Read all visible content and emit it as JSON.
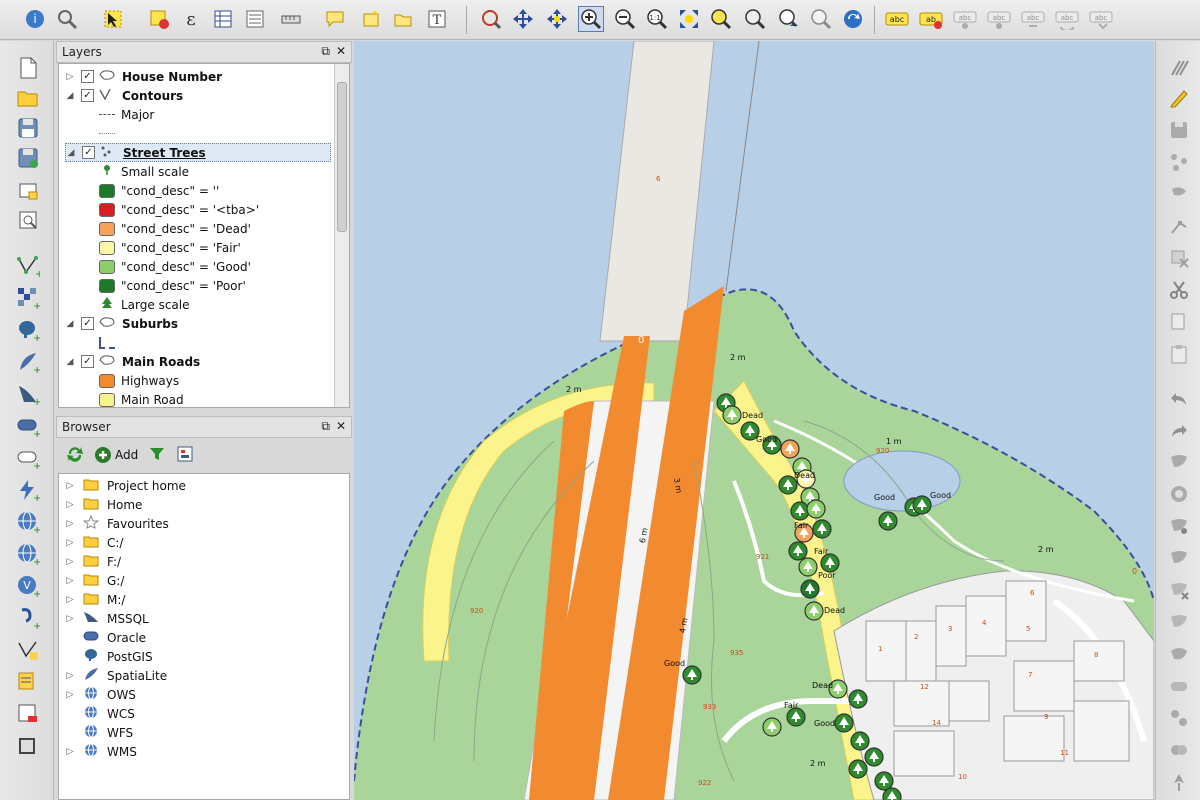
{
  "layers_panel": {
    "title": "Layers",
    "float_glyph": "⧉",
    "close_glyph": "✕",
    "items": [
      {
        "label": "House Number",
        "type": "group",
        "bold": true,
        "checked": true,
        "icon": "polygon-layer-icon"
      },
      {
        "label": "Contours",
        "type": "group",
        "bold": true,
        "checked": true,
        "icon": "line-layer-icon"
      },
      {
        "label": "Major",
        "type": "legend",
        "symbol": "dashed-line"
      },
      {
        "label": "",
        "type": "legend",
        "symbol": "dotted-line"
      },
      {
        "label": "Street Trees",
        "type": "group",
        "bold": true,
        "checked": true,
        "selected": true,
        "icon": "point-layer-icon"
      },
      {
        "label": "Small scale",
        "type": "legend",
        "symbol": "small-tree",
        "color": "#2e8b2e"
      },
      {
        "label": "\"cond_desc\" = ''",
        "type": "legend",
        "symbol": "swatch",
        "color": "#1d7a2a"
      },
      {
        "label": "\"cond_desc\" = '<tba>'",
        "type": "legend",
        "symbol": "swatch",
        "color": "#d81e1e"
      },
      {
        "label": "\"cond_desc\" = 'Dead'",
        "type": "legend",
        "symbol": "swatch",
        "color": "#f5a25a"
      },
      {
        "label": "\"cond_desc\" = 'Fair'",
        "type": "legend",
        "symbol": "swatch",
        "color": "#fbf6a8"
      },
      {
        "label": "\"cond_desc\" = 'Good'",
        "type": "legend",
        "symbol": "swatch",
        "color": "#8ccf6a"
      },
      {
        "label": "\"cond_desc\" = 'Poor'",
        "type": "legend",
        "symbol": "swatch",
        "color": "#1d7a2a"
      },
      {
        "label": "Large scale",
        "type": "legend",
        "symbol": "large-tree",
        "color": "#2e8b2e"
      },
      {
        "label": "Suburbs",
        "type": "group",
        "bold": true,
        "checked": true,
        "icon": "polygon-layer-icon"
      },
      {
        "label": "",
        "type": "legend",
        "symbol": "dashed-blue"
      },
      {
        "label": "Main Roads",
        "type": "group",
        "bold": true,
        "checked": true,
        "icon": "polygon-layer-icon"
      },
      {
        "label": "Highways",
        "type": "legend",
        "symbol": "swatch",
        "color": "#f28a30"
      },
      {
        "label": "Main Road",
        "type": "legend",
        "symbol": "swatch",
        "color": "#fbf48c"
      }
    ]
  },
  "browser_panel": {
    "title": "Browser",
    "float_glyph": "⧉",
    "close_glyph": "✕",
    "add_label": "Add",
    "items": [
      {
        "label": "Project home",
        "icon": "folder-icon",
        "expandable": true
      },
      {
        "label": "Home",
        "icon": "folder-icon",
        "expandable": true
      },
      {
        "label": "Favourites",
        "icon": "star-icon",
        "expandable": true
      },
      {
        "label": "C:/",
        "icon": "folder-icon",
        "expandable": true
      },
      {
        "label": "F:/",
        "icon": "folder-icon",
        "expandable": true
      },
      {
        "label": "G:/",
        "icon": "folder-icon",
        "expandable": true
      },
      {
        "label": "M:/",
        "icon": "folder-icon",
        "expandable": true
      },
      {
        "label": "MSSQL",
        "icon": "mssql-icon",
        "expandable": true
      },
      {
        "label": "Oracle",
        "icon": "oracle-icon",
        "expandable": false
      },
      {
        "label": "PostGIS",
        "icon": "postgis-icon",
        "expandable": false
      },
      {
        "label": "SpatiaLite",
        "icon": "spatialite-icon",
        "expandable": true
      },
      {
        "label": "OWS",
        "icon": "globe-icon",
        "expandable": true
      },
      {
        "label": "WCS",
        "icon": "globe-icon",
        "expandable": false
      },
      {
        "label": "WFS",
        "icon": "globe-icon",
        "expandable": false
      },
      {
        "label": "WMS",
        "icon": "globe-icon",
        "expandable": true
      }
    ]
  },
  "map": {
    "labels": {
      "two_m": "2 m",
      "one_m": "1 m",
      "three_m": "3 m",
      "six_m": "6 m",
      "four_m": "4 m",
      "zero": "0",
      "dead": "Dead",
      "good": "Good",
      "fair": "Fair",
      "poor": "Poor"
    },
    "parcel_numbers": [
      "1",
      "2",
      "3",
      "4",
      "5",
      "6",
      "7",
      "8",
      "9",
      "10",
      "11",
      "12",
      "14"
    ],
    "area_numbers": [
      "920",
      "921",
      "933",
      "935",
      "922",
      "920",
      "6"
    ]
  },
  "colors": {
    "water": "#b8cfe8",
    "park": "#a9d49a",
    "highway": "#f28a30",
    "main_road": "#fbf48c",
    "suburb_border": "#3b4f9a",
    "urban": "#efefef"
  }
}
